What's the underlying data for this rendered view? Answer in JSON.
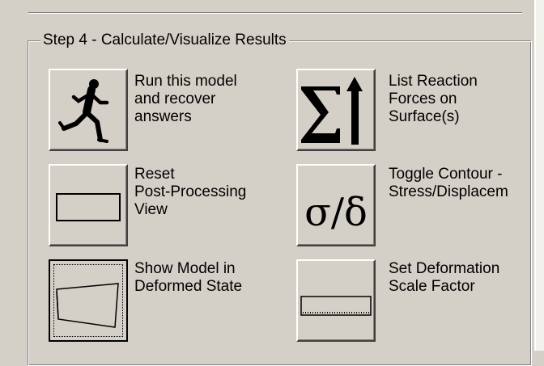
{
  "group": {
    "title": "Step 4 - Calculate/Visualize Results"
  },
  "buttons": [
    {
      "icon": "runner-icon",
      "label": [
        "Run this model",
        "and recover",
        "answers"
      ]
    },
    {
      "icon": "sum-arrow-icon",
      "label": [
        "List Reaction",
        "Forces on",
        "Surface(s)"
      ]
    },
    {
      "icon": "rectangle-icon",
      "label": [
        "Reset",
        "Post-Processing",
        "View"
      ]
    },
    {
      "icon": "sigma-delta-icon",
      "glyph": "σ/δ",
      "label": [
        "Toggle Contour -",
        "Stress/Displacem"
      ]
    },
    {
      "icon": "deformed-shape-icon",
      "label": [
        "Show Model in",
        "Deformed State"
      ]
    },
    {
      "icon": "scale-ruler-icon",
      "label": [
        "Set Deformation",
        "Scale Factor"
      ]
    }
  ]
}
